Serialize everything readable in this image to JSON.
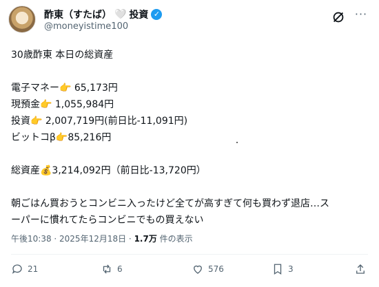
{
  "header": {
    "display_name": "酢東（すたば）",
    "heart": "🤍",
    "name_suffix": "投資",
    "verified": "✓",
    "handle": "@moneyistime100",
    "more": "···"
  },
  "post": {
    "line1": "30歳酢東 本日の総資産",
    "e_money": "電子マネー👉 65,173円",
    "cash": "現預金👉 1,055,984円",
    "invest": "投資👉 2,007,719円(前日比-11,091円)",
    "bitcoin": "ビットコβ👉85,216円",
    "total": "総資産💰3,214,092円（前日比-13,720円）",
    "comment1": "朝ごはん買おうとコンビニ入ったけど全てが高すぎて何も買わず退店…ス",
    "comment2": "ーパーに慣れてたらコンビニでもの買えない"
  },
  "meta": {
    "time": "午後10:38 · 2025年12月18日 · ",
    "views_count": "1.7万",
    "views_label": " 件の表示"
  },
  "actions": {
    "replies": "21",
    "reposts": "6",
    "likes": "576",
    "bookmarks": "3"
  }
}
